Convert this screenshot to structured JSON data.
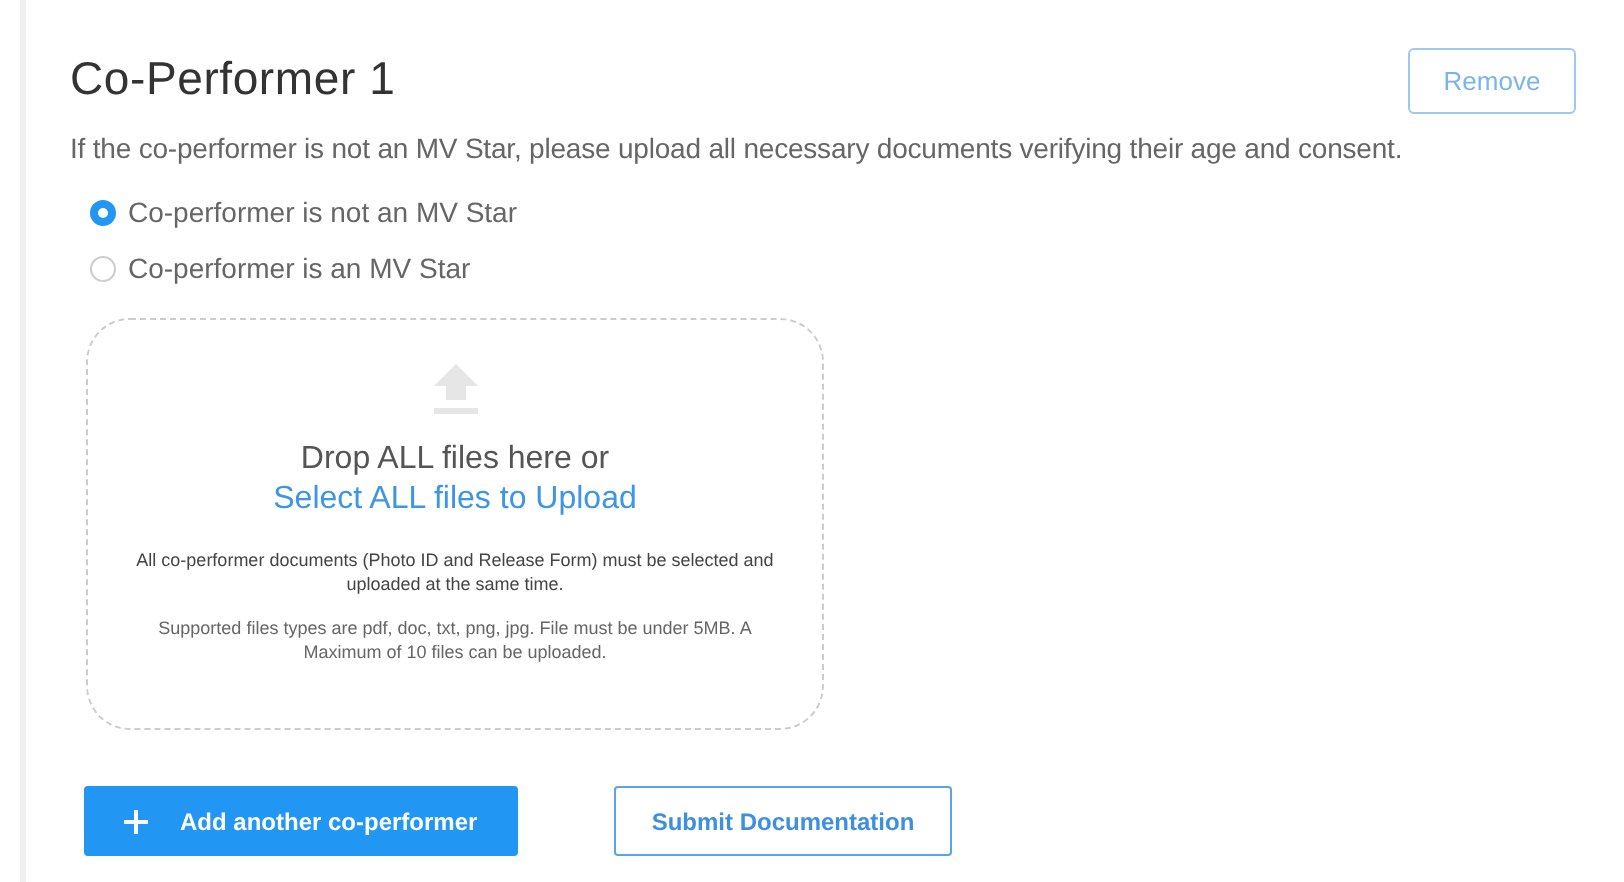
{
  "title": "Co-Performer 1",
  "remove_button": "Remove",
  "description": "If the co-performer is not an MV Star, please upload all necessary documents verifying their age and consent.",
  "options": [
    {
      "label": "Co-performer is not an MV Star",
      "selected": true
    },
    {
      "label": "Co-performer is an MV Star",
      "selected": false
    }
  ],
  "dropzone": {
    "prompt": "Drop ALL files here or",
    "link": "Select ALL files to Upload",
    "note": "All co-performer documents (Photo ID and Release Form) must be selected and uploaded at the same time.",
    "hint": "Supported files types are pdf, doc, txt, png, jpg. File must be under 5MB. A Maximum of 10 files can be uploaded."
  },
  "buttons": [
    {
      "kind": "primary",
      "label": "Add another co-performer"
    },
    {
      "kind": "outline",
      "label": "Submit Documentation"
    }
  ]
}
